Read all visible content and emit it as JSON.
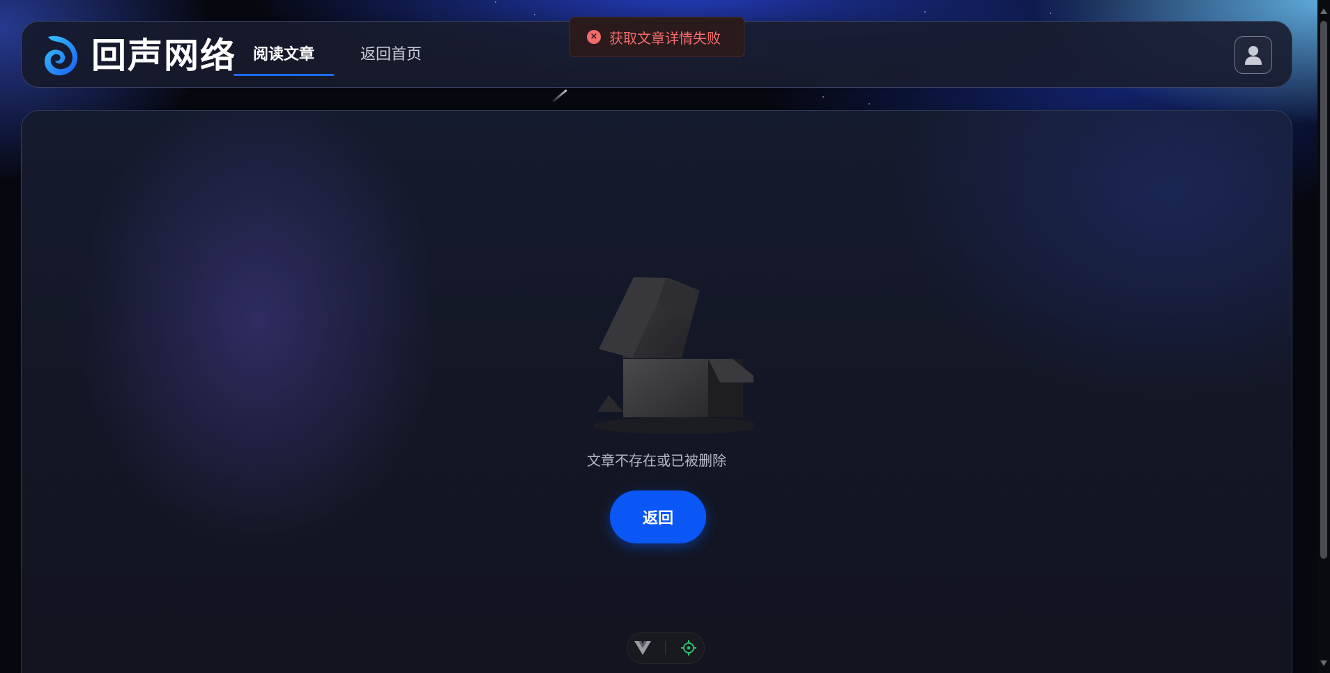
{
  "header": {
    "brand": "回声网络",
    "tabs": [
      {
        "label": "阅读文章",
        "active": true
      },
      {
        "label": "返回首页",
        "active": false
      }
    ]
  },
  "toast": {
    "type": "error",
    "message": "获取文章详情失败"
  },
  "main": {
    "empty_text": "文章不存在或已被删除",
    "back_button": "返回"
  },
  "icons": {
    "logo": "swirl-logo-icon",
    "user": "user-icon",
    "toast": "error-circle-icon",
    "empty": "empty-box-icon",
    "devtools_vue": "vue-icon",
    "devtools_inspect": "target-icon"
  },
  "colors": {
    "accent": "#0b57f5",
    "tab_underline": "#1f6bff",
    "error": "#f56c6c",
    "devtools_target": "#2fbf71"
  }
}
